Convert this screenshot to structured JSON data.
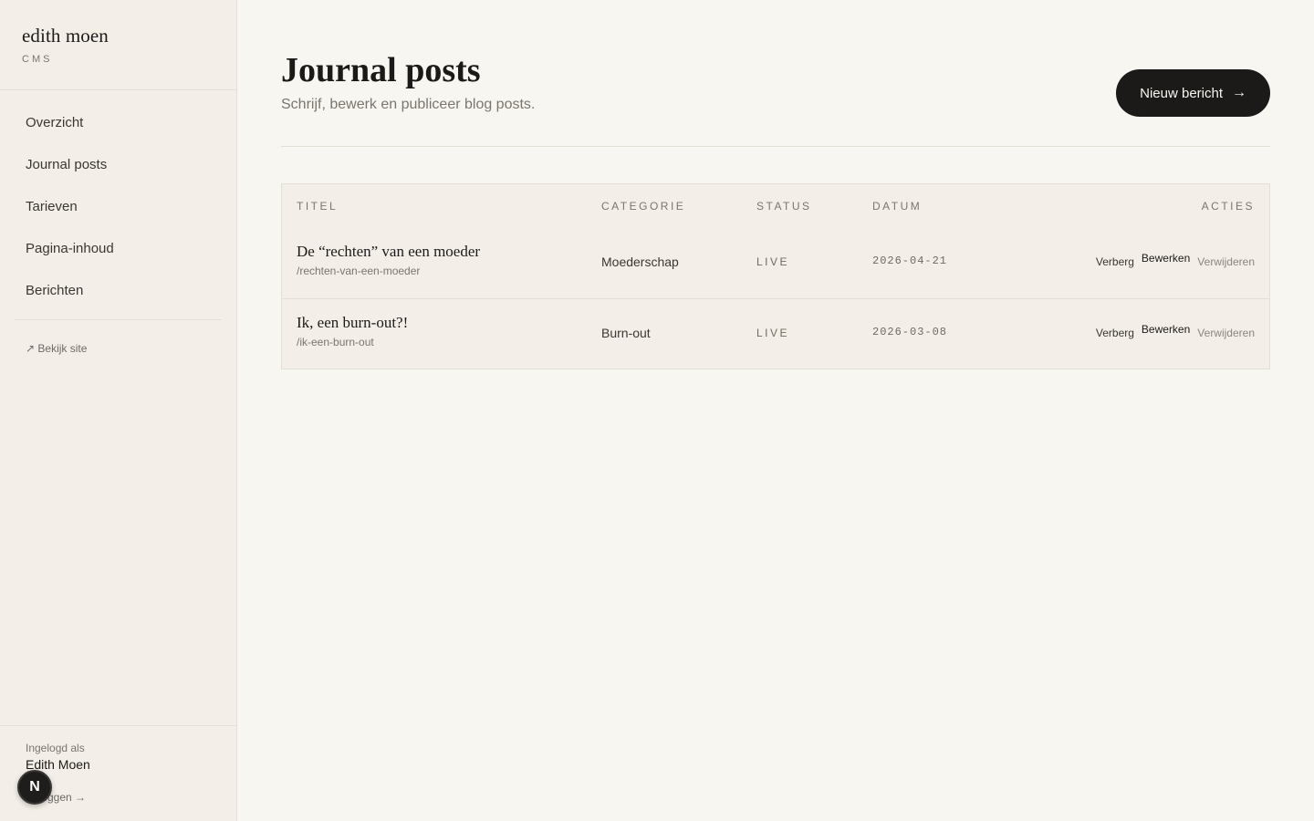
{
  "sidebar": {
    "brand_name": "edith moen",
    "brand_sub": "CMS",
    "nav": [
      {
        "label": "Overzicht"
      },
      {
        "label": "Journal posts"
      },
      {
        "label": "Tarieven"
      },
      {
        "label": "Pagina-inhoud"
      },
      {
        "label": "Berichten"
      }
    ],
    "view_site": "↗ Bekijk site",
    "logged_in_label": "Ingelogd als",
    "user_name": "Edith Moen",
    "logout": "Uitloggen →",
    "badge": "N"
  },
  "header": {
    "title": "Journal posts",
    "subtitle": "Schrijf, bewerk en publiceer blog posts.",
    "new_button": "Nieuw bericht",
    "new_button_arrow": "→"
  },
  "table": {
    "columns": {
      "title": "TITEL",
      "category": "CATEGORIE",
      "status": "STATUS",
      "date": "DATUM",
      "actions": "ACTIES"
    },
    "rows": [
      {
        "title": "De “rechten” van een moeder",
        "slug": "/rechten-van-een-moeder",
        "category": "Moederschap",
        "status": "LIVE",
        "date": "2026-04-21",
        "actions": {
          "hide": "Verberg",
          "edit": "Bewerken",
          "delete": "Verwijderen"
        }
      },
      {
        "title": "Ik, een burn-out?!",
        "slug": "/ik-een-burn-out",
        "category": "Burn-out",
        "status": "LIVE",
        "date": "2026-03-08",
        "actions": {
          "hide": "Verberg",
          "edit": "Bewerken",
          "delete": "Verwijderen"
        }
      }
    ]
  }
}
